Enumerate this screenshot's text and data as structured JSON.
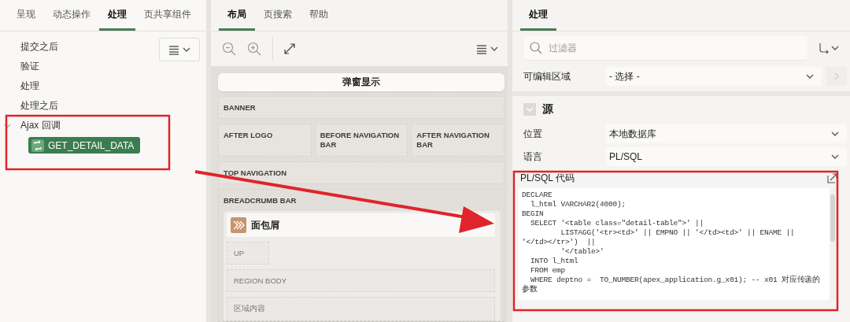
{
  "left_panel": {
    "tabs": [
      {
        "label": "呈现",
        "selected": false
      },
      {
        "label": "动态操作",
        "selected": false
      },
      {
        "label": "处理",
        "selected": true
      },
      {
        "label": "页共享组件",
        "selected": false
      }
    ],
    "tree": [
      {
        "label": "提交之后",
        "selected": false
      },
      {
        "label": "验证",
        "selected": false
      },
      {
        "label": "处理",
        "selected": false
      },
      {
        "label": "处理之后",
        "selected": false
      },
      {
        "label": "Ajax 回调",
        "selected": false,
        "expanded": true,
        "children": [
          {
            "label": "GET_DETAIL_DATA",
            "selected": true
          }
        ]
      }
    ]
  },
  "layout_panel": {
    "tabs": [
      {
        "label": "布局",
        "selected": true
      },
      {
        "label": "页搜索",
        "selected": false
      },
      {
        "label": "帮助",
        "selected": false
      }
    ],
    "canvas": {
      "title": "弹窗显示",
      "banner": "BANNER",
      "banner_slots": [
        "AFTER LOGO",
        "BEFORE NAVIGATION BAR",
        "AFTER NAVIGATION BAR"
      ],
      "top_navigation": "TOP NAVIGATION",
      "breadcrumb_bar": "BREADCRUMB BAR",
      "region": {
        "title": "面包屑",
        "slots": [
          {
            "label": "UP",
            "kind": "compact"
          },
          {
            "label": "REGION BODY",
            "kind": "wide"
          },
          {
            "label": "区域内容",
            "kind": "wide"
          }
        ]
      }
    }
  },
  "properties_panel": {
    "tabs": [
      {
        "label": "处理",
        "selected": true
      }
    ],
    "filter": {
      "placeholder": "过滤器"
    },
    "editable_region": {
      "label": "可编辑区域",
      "value": "- 选择 -"
    },
    "source": {
      "title": "源",
      "expanded": true,
      "fields": [
        {
          "label": "位置",
          "value": "本地数据库"
        },
        {
          "label": "语言",
          "value": "PL/SQL"
        }
      ],
      "code": {
        "label": "PL/SQL 代码",
        "lines": [
          "DECLARE",
          "  l_html VARCHAR2(4000);",
          "BEGIN",
          "  SELECT '<table class=\"detail-table\">' ||",
          "         LISTAGG('<tr><td>' || EMPNO || '</td><td>' || ENAME ||",
          "'</td></tr>')  ||",
          "         '</table>'",
          "  INTO l_html",
          "  FROM emp",
          "  WHERE deptno =  TO_NUMBER(apex_application.g_x01); -- x01 对应传递的",
          "参数"
        ]
      }
    }
  }
}
